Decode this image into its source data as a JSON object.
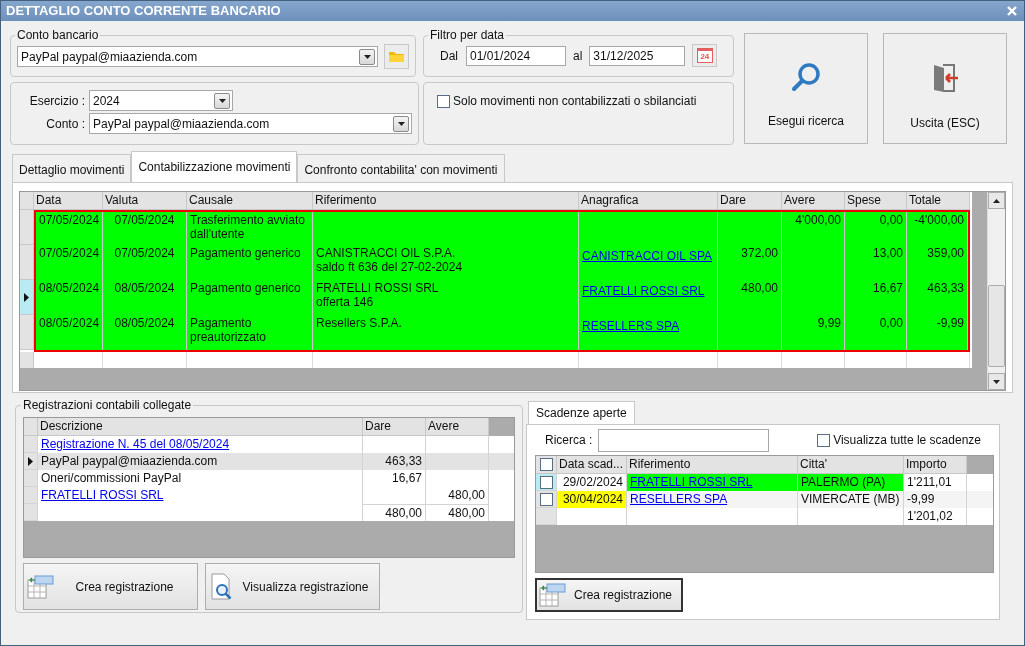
{
  "window": {
    "title": "DETTAGLIO CONTO CORRENTE BANCARIO"
  },
  "conto_bancario": {
    "legend": "Conto bancario",
    "value": "PayPal paypal@miaazienda.com"
  },
  "filtro_data": {
    "legend": "Filtro per data",
    "from_label": "Dal",
    "from": "01/01/2024",
    "to_label": "al",
    "to": "31/12/2025",
    "calendar_day": "24"
  },
  "esercizio": {
    "label": "Esercizio :",
    "value": "2024",
    "conto_label": "Conto :",
    "conto_value": "PayPal paypal@miaazienda.com"
  },
  "filter_option": {
    "label": "Solo movimenti non contabilizzati o sbilanciati",
    "checked": false
  },
  "buttons": [
    {
      "kind": "search",
      "label": "Esegui ricerca"
    },
    {
      "kind": "exit",
      "label": "Uscita (ESC)"
    }
  ],
  "tabs": [
    {
      "label": "Dettaglio movimenti",
      "selected": false
    },
    {
      "label": "Contabilizzazione movimenti",
      "selected": true
    },
    {
      "label": "Confronto contabilita' con movimenti",
      "selected": false
    }
  ],
  "movements": {
    "columns": [
      "Data",
      "Valuta",
      "Causale",
      "Riferimento",
      "Anagrafica",
      "Dare",
      "Avere",
      "Spese",
      "Totale"
    ],
    "rows": [
      {
        "data": "07/05/2024",
        "valuta": "07/05/2024",
        "causale": "Trasferimento avviato\ndall'utente",
        "avere": "4'000,00",
        "spese": "0,00",
        "totale": "-4'000,00",
        "color": "#00ff00",
        "selected": false
      },
      {
        "data": "07/05/2024",
        "valuta": "07/05/2024",
        "causale": "Pagamento generico",
        "riferimento": "CANISTRACCI OIL S.P.A.\nsaldo ft 636 del 27-02-2024",
        "anagrafica": "CANISTRACCI OIL SPA",
        "dare": "372,00",
        "spese": "13,00",
        "totale": "359,00",
        "color": "#00ff00",
        "selected": false
      },
      {
        "data": "08/05/2024",
        "valuta": "08/05/2024",
        "causale": "Pagamento generico",
        "riferimento": "FRATELLI ROSSI SRL\nofferta 146",
        "anagrafica": "FRATELLI ROSSI SRL",
        "dare": "480,00",
        "spese": "16,67",
        "totale": "463,33",
        "color": "#00ff00",
        "selected": true
      },
      {
        "data": "08/05/2024",
        "valuta": "08/05/2024",
        "causale": "Pagamento\npreautorizzato",
        "riferimento": "Resellers S.P.A.",
        "anagrafica": "RESELLERS SPA",
        "avere": "9,99",
        "spese": "0,00",
        "totale": "-9,99",
        "color": "#00ff00",
        "selected": false
      }
    ]
  },
  "registrazioni": {
    "legend": "Registrazioni contabili collegate",
    "columns": [
      "Descrizione",
      "Dare",
      "Avere"
    ],
    "rows": [
      {
        "kind": "link",
        "descrizione": "Registrazione N. 45 del 08/05/2024",
        "selected": false
      },
      {
        "kind": "text",
        "descrizione": "PayPal paypal@miaazienda.com",
        "dare": "463,33",
        "selected": true
      },
      {
        "kind": "text",
        "descrizione": "Oneri/commissioni PayPal",
        "dare": "16,67",
        "selected": false
      },
      {
        "kind": "link",
        "descrizione": "FRATELLI ROSSI SRL",
        "avere": "480,00",
        "selected": false
      },
      {
        "kind": "total",
        "dare": "480,00",
        "avere": "480,00",
        "selected": false
      }
    ],
    "buttons": [
      {
        "kind": "create",
        "label": "Crea registrazione"
      },
      {
        "kind": "view",
        "label": "Visualizza registrazione"
      }
    ]
  },
  "scadenze": {
    "tab": "Scadenze aperte",
    "search_label": "Ricerca :",
    "show_all": {
      "label": "Visualizza tutte le scadenze",
      "checked": false
    },
    "header_checked": false,
    "columns": [
      "Data scad...",
      "Riferimento",
      "Citta'",
      "Importo"
    ],
    "rows": [
      {
        "kind": "item",
        "checked": false,
        "selected": true,
        "data": {
          "text": "29/02/2024"
        },
        "riferimento": {
          "text": "FRATELLI ROSSI SRL",
          "color": "#00ff00"
        },
        "citta": {
          "text": "PALERMO (PA)",
          "color": "#00ff00"
        },
        "importo": "1'211,01"
      },
      {
        "kind": "item",
        "checked": false,
        "selected": false,
        "data": {
          "text": "30/04/2024",
          "color": "#ffff00"
        },
        "riferimento": {
          "text": "RESELLERS SPA"
        },
        "citta": {
          "text": "VIMERCATE (MB)"
        },
        "importo": "-9,99"
      },
      {
        "kind": "total",
        "selected": false,
        "importo": "1'201,02"
      }
    ],
    "button": {
      "kind": "create",
      "label": "Crea registrazione"
    }
  }
}
